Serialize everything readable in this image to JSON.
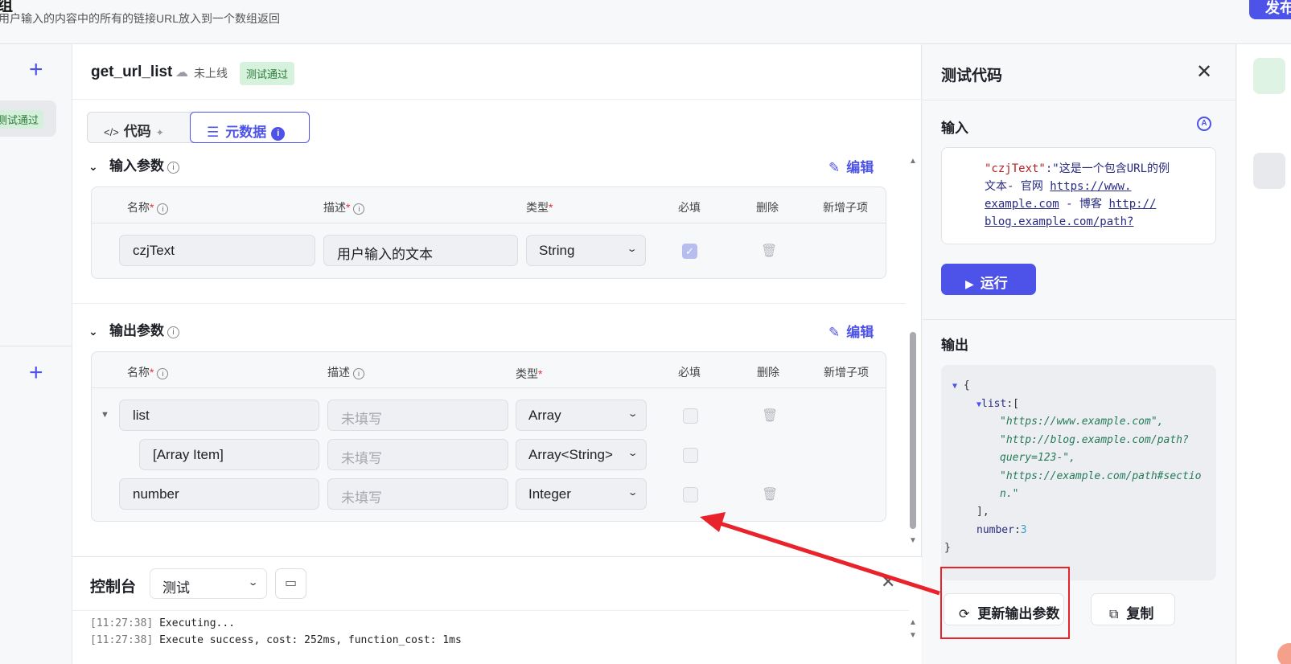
{
  "header": {
    "title": "组",
    "subtitle": "用户输入的内容中的所有的链接URL放入到一个数组返回",
    "publish_label": "发布"
  },
  "left_rail": {
    "badge": "测试通过"
  },
  "tool": {
    "name": "get_url_list",
    "status": "未上线",
    "test_badge": "测试通过"
  },
  "tabs": [
    {
      "label": "代码",
      "active": false
    },
    {
      "label": "元数据",
      "active": true
    }
  ],
  "input_params": {
    "title": "输入参数",
    "edit_label": "编辑",
    "columns": [
      "名称",
      "描述",
      "类型",
      "必填",
      "删除",
      "新增子项"
    ],
    "rows": [
      {
        "name": "czjText",
        "desc": "用户输入的文本",
        "type": "String",
        "required": true
      }
    ]
  },
  "output_params": {
    "title": "输出参数",
    "edit_label": "编辑",
    "columns": [
      "名称",
      "描述",
      "类型",
      "必填",
      "删除",
      "新增子项"
    ],
    "rows": [
      {
        "name": "list",
        "desc_placeholder": "未填写",
        "type": "Array",
        "required": false
      },
      {
        "name": "[Array Item]",
        "desc_placeholder": "未填写",
        "type": "Array<String>",
        "required": false
      },
      {
        "name": "number",
        "desc_placeholder": "未填写",
        "type": "Integer",
        "required": false
      }
    ]
  },
  "console": {
    "title": "控制台",
    "mode": "测试",
    "logs": [
      {
        "ts": "[11:27:38]",
        "msg": " Executing..."
      },
      {
        "ts": "[11:27:38]",
        "msg": " Execute success, cost: 252ms, function_cost: 1ms"
      }
    ]
  },
  "test_panel": {
    "title": "测试代码",
    "input_label": "输入",
    "input_key": "\"czjText\"",
    "input_colon": ":",
    "input_text_1": "\"这是一个包含URL的例",
    "input_text_2": "文本- 官网 ",
    "input_link_1a": "https://www.",
    "input_link_1b": "example.com",
    "input_text_3": " - 博客 ",
    "input_link_2a": "http://",
    "input_link_2b": "blog.example.com/path?",
    "run_label": "运行",
    "output_label": "输出",
    "output_lines": {
      "open": "{",
      "list_key": "list",
      "list_open": ":[",
      "item1": "\"https://www.example.com\",",
      "item2a": "\"http://blog.example.com/path?",
      "item2b": "query=123-\",",
      "item3a": "\"https://example.com/path#sectio",
      "item3b": "n.\"",
      "list_close": "],",
      "number_key": "number",
      "number_val": "3",
      "close": "}"
    },
    "update_label": "更新输出参数",
    "copy_label": "复制"
  }
}
